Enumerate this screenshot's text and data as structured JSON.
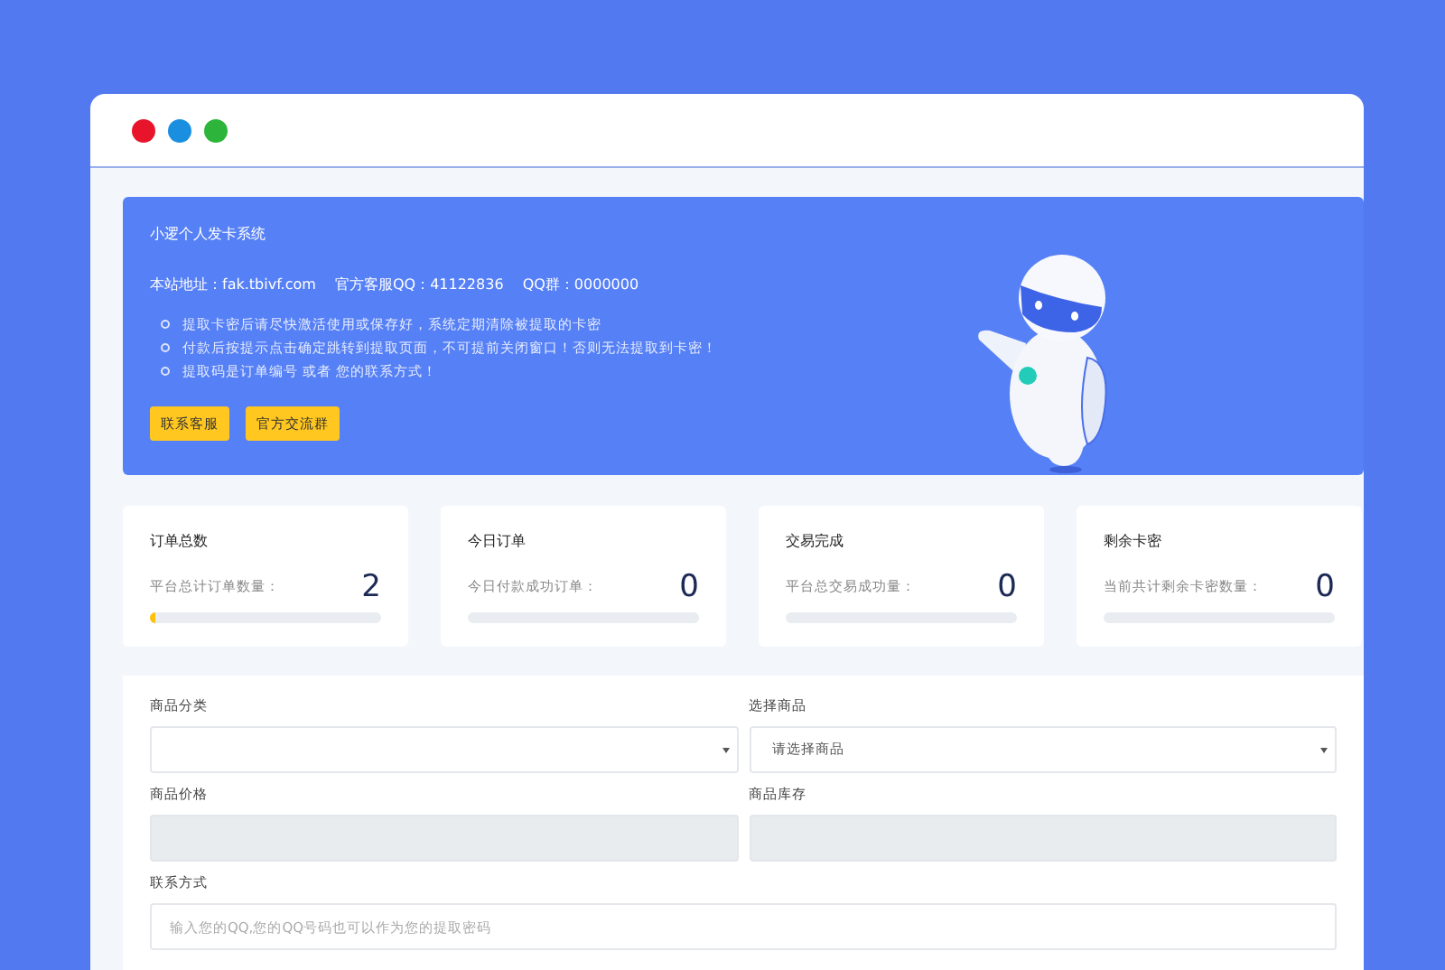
{
  "hero": {
    "title": "小逻个人发卡系统",
    "info": "本站地址：fak.tbivf.com　 官方客服QQ：41122836 　QQ群：0000000",
    "notes": [
      "提取卡密后请尽快激活使用或保存好，系统定期清除被提取的卡密",
      "付款后按提示点击确定跳转到提取页面，不可提前关闭窗口！否则无法提取到卡密！",
      "提取码是订单编号 或者 您的联系方式！"
    ],
    "buttons": [
      "联系客服",
      "官方交流群"
    ]
  },
  "stats": [
    {
      "title": "订单总数",
      "label": "平台总计订单数量：",
      "value": "2",
      "level": 0.02
    },
    {
      "title": "今日订单",
      "label": "今日付款成功订单：",
      "value": "0",
      "level": 0
    },
    {
      "title": "交易完成",
      "label": "平台总交易成功量：",
      "value": "0",
      "level": 0
    },
    {
      "title": "剩余卡密",
      "label": "当前共计剩余卡密数量：",
      "value": "0",
      "level": 0
    }
  ],
  "form": {
    "fields": [
      {
        "label": "商品分类",
        "kind": "select"
      },
      {
        "label": "选择商品",
        "kind": "select",
        "value": "请选择商品"
      },
      {
        "label": "商品价格",
        "kind": "readonly"
      },
      {
        "label": "商品库存",
        "kind": "readonly"
      },
      {
        "label": "联系方式",
        "kind": "text",
        "placeholder": "输入您的QQ,您的QQ号码也可以作为您的提取密码"
      }
    ]
  }
}
